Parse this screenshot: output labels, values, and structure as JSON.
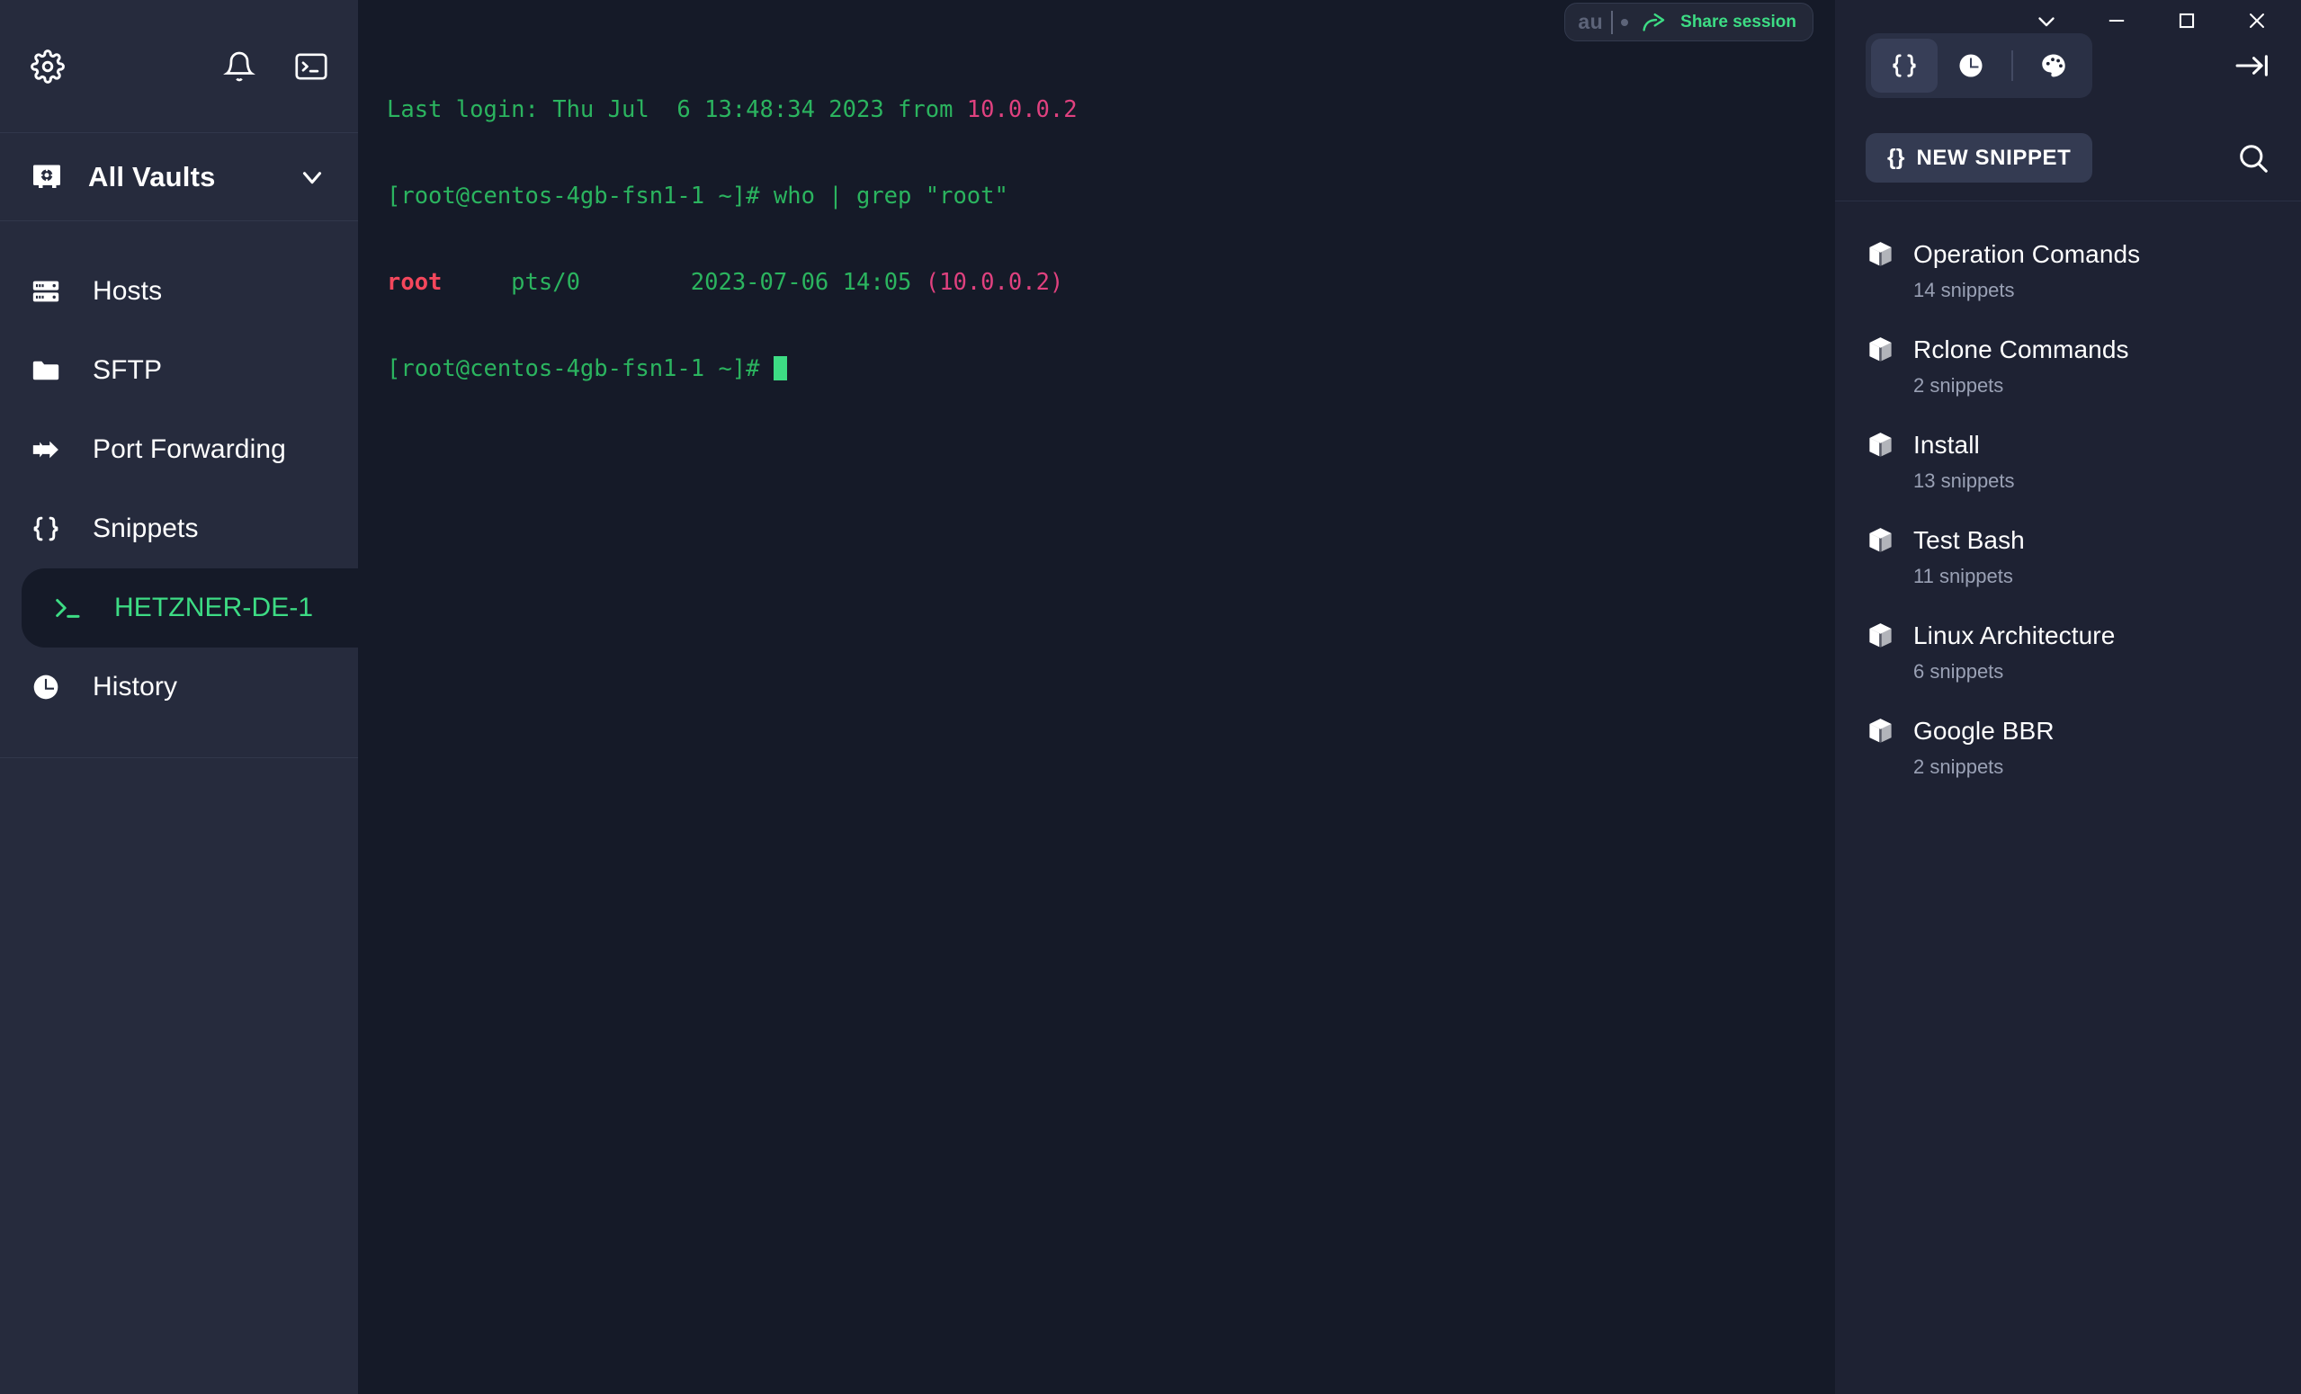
{
  "window": {
    "controls": [
      {
        "name": "chevron-down",
        "glyph": "chev"
      },
      {
        "name": "minimize",
        "glyph": "min"
      },
      {
        "name": "maximize",
        "glyph": "max"
      },
      {
        "name": "close",
        "glyph": "close"
      }
    ]
  },
  "sidebar": {
    "top_icons": [
      {
        "name": "gear-icon",
        "label": "Settings"
      },
      {
        "name": "bell-icon",
        "label": "Notifications"
      },
      {
        "name": "terminal-icon",
        "label": "New terminal"
      }
    ],
    "vault": {
      "icon": "vault-icon",
      "label": "All Vaults",
      "chevron": "chevron-down-icon"
    },
    "items": [
      {
        "id": "hosts",
        "label": "Hosts",
        "icon": "server-icon",
        "active": false
      },
      {
        "id": "sftp",
        "label": "SFTP",
        "icon": "folder-icon",
        "active": false
      },
      {
        "id": "port-forwarding",
        "label": "Port Forwarding",
        "icon": "forward-arrow-icon",
        "active": false
      },
      {
        "id": "snippets",
        "label": "Snippets",
        "icon": "braces-icon",
        "active": false
      },
      {
        "id": "hetzner-de-1",
        "label": "HETZNER-DE-1",
        "icon": "prompt-icon",
        "active": true
      },
      {
        "id": "history",
        "label": "History",
        "icon": "clock-icon",
        "active": false
      }
    ],
    "accent_green": "#3ddc84"
  },
  "terminal": {
    "lines": [
      [
        {
          "text": "Last login: Thu Jul  6 13:48:34 2023 from ",
          "color": "green"
        },
        {
          "text": "10.0.0.2",
          "color": "pink"
        }
      ],
      [
        {
          "text": "[root@centos-4gb-fsn1-1 ~]# who | grep \"root\"",
          "color": "green"
        }
      ],
      [
        {
          "text": "root",
          "color": "red"
        },
        {
          "text": "     pts/0        2023-07-06 14:05 ",
          "color": "green"
        },
        {
          "text": "(10.0.0.2)",
          "color": "pink"
        }
      ],
      [
        {
          "text": "[root@centos-4gb-fsn1-1 ~]# ",
          "color": "green"
        },
        {
          "text": "",
          "color": "cursor"
        }
      ]
    ],
    "colors": {
      "green": "#2bb45f",
      "pink": "#e0417f",
      "red": "#f4475c",
      "background": "#151a28",
      "cursor": "#3ddc84"
    }
  },
  "share_session": {
    "badge": "au",
    "label": "Share session",
    "icon": "share-arrow-icon"
  },
  "right_panel": {
    "segments": [
      {
        "id": "snippets",
        "icon": "braces-icon",
        "active": true
      },
      {
        "id": "history",
        "icon": "clock-icon",
        "active": false
      },
      {
        "id": "theme",
        "icon": "palette-icon",
        "active": false
      }
    ],
    "collapse_icon": "collapse-right-icon",
    "new_snippet": {
      "braces": "{}",
      "label": "NEW SNIPPET"
    },
    "search_icon": "search-icon",
    "snippets": [
      {
        "title": "Operation Comands",
        "count": "14 snippets",
        "icon": "package-icon"
      },
      {
        "title": "Rclone Commands",
        "count": "2 snippets",
        "icon": "package-icon"
      },
      {
        "title": "Install",
        "count": "13 snippets",
        "icon": "package-icon"
      },
      {
        "title": "Test Bash",
        "count": "11 snippets",
        "icon": "package-icon"
      },
      {
        "title": "Linux Architecture",
        "count": "6 snippets",
        "icon": "package-icon"
      },
      {
        "title": "Google BBR",
        "count": "2 snippets",
        "icon": "package-icon"
      }
    ]
  }
}
